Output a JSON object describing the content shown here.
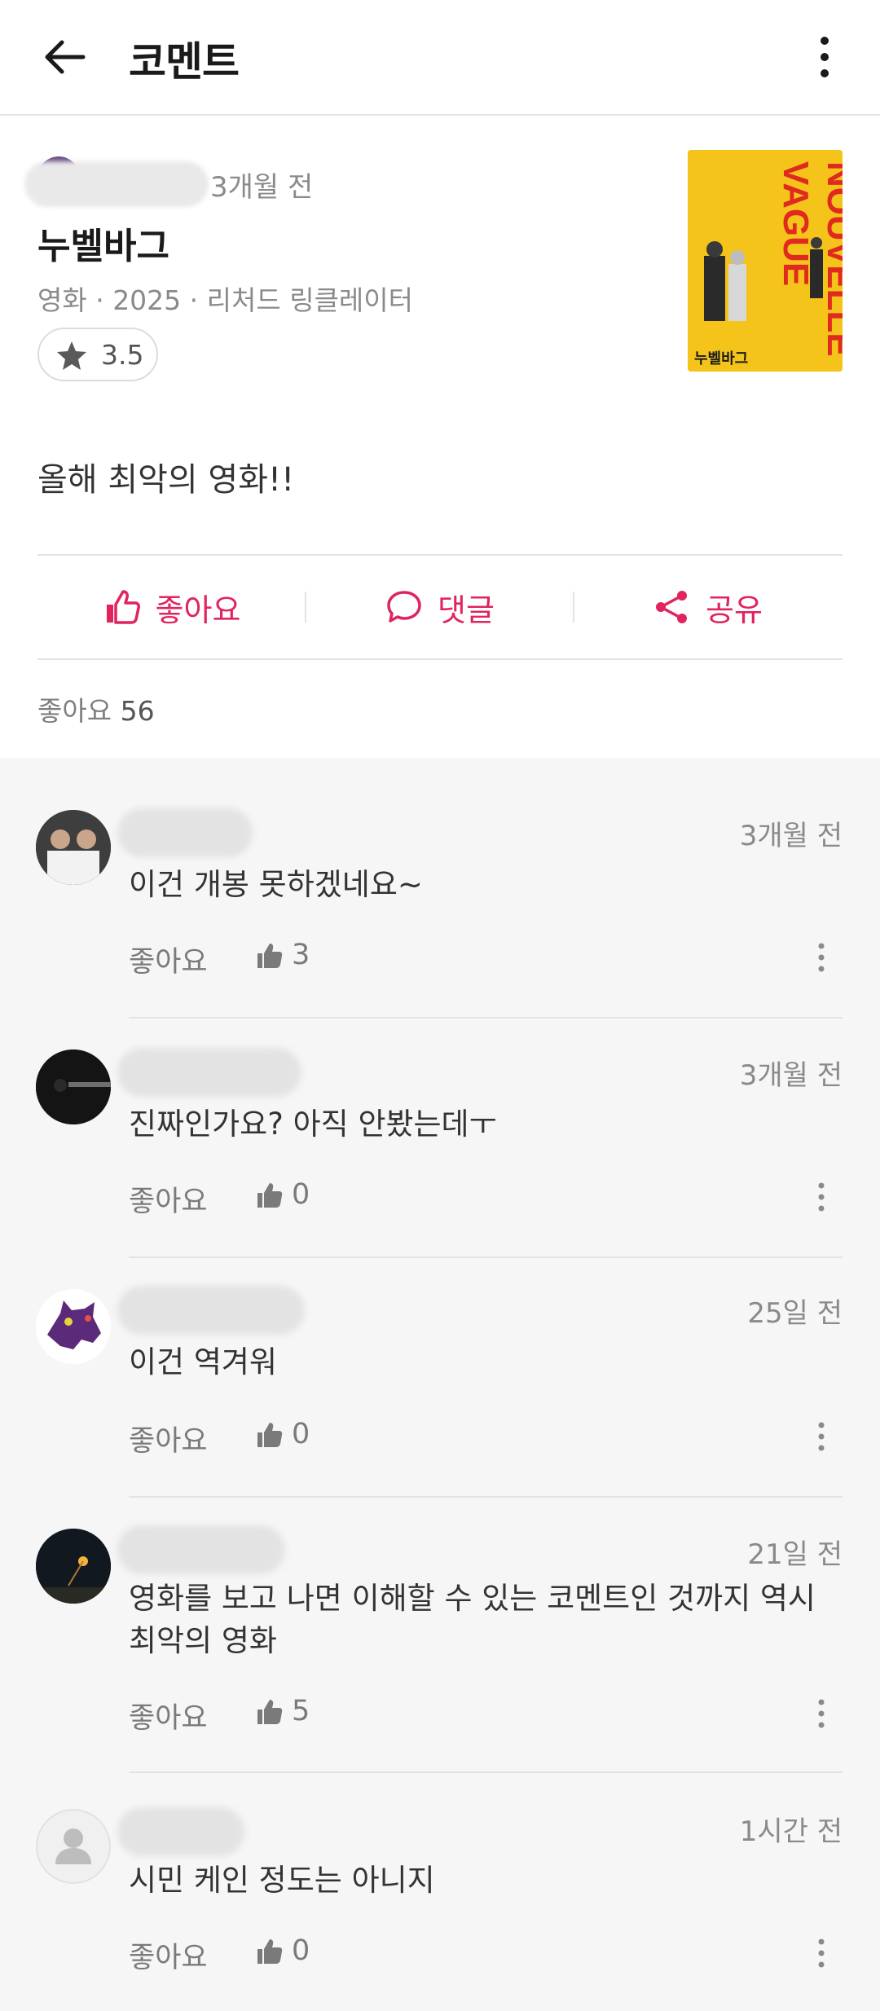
{
  "header": {
    "title": "코멘트"
  },
  "post": {
    "time": "3개월 전",
    "work_title": "누벨바그",
    "work_meta": "영화 · 2025 · 리처드 링클레이터",
    "rating": "3.5",
    "comment": "올해 최악의 영화!!",
    "actions": {
      "like": "좋아요",
      "reply": "댓글",
      "share": "공유"
    },
    "likes_label": "좋아요",
    "likes_count": "56",
    "poster": {
      "title_text": "NOUVELLE VAGUE",
      "kr_title": "누벨바그"
    }
  },
  "replies": [
    {
      "time": "3개월 전",
      "text": "이건 개봉 못하겠네요~",
      "like_label": "좋아요",
      "like_count": "3"
    },
    {
      "time": "3개월 전",
      "text": "진짜인가요? 아직 안봤는데ㅜ",
      "like_label": "좋아요",
      "like_count": "0"
    },
    {
      "time": "25일 전",
      "text": "이건 역겨워",
      "like_label": "좋아요",
      "like_count": "0"
    },
    {
      "time": "21일 전",
      "text": "영화를 보고 나면 이해할 수 있는 코멘트인 것까지 역시 최악의 영화",
      "like_label": "좋아요",
      "like_count": "5"
    },
    {
      "time": "1시간 전",
      "text": "시민 케인 정도는 아니지",
      "like_label": "좋아요",
      "like_count": "0"
    }
  ],
  "colors": {
    "accent": "#e0245e",
    "background": "#f6f6f6"
  }
}
